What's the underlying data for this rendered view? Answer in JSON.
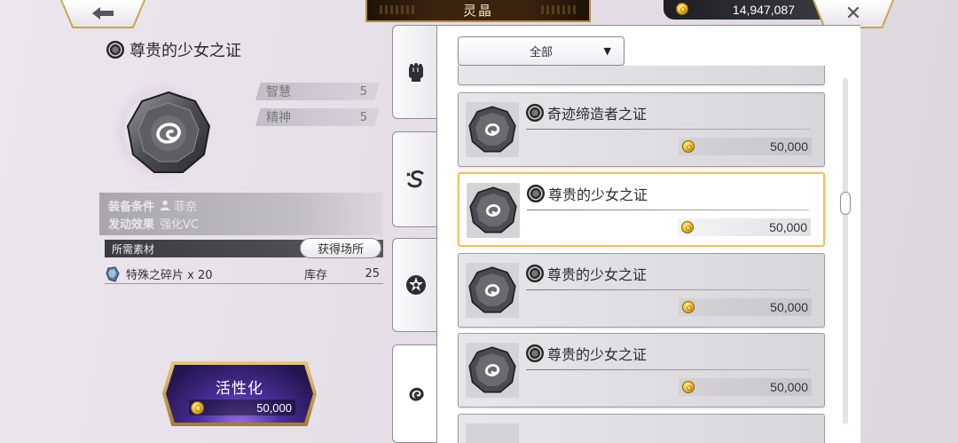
{
  "header": {
    "title": "灵晶",
    "currency_amount": "14,947,087"
  },
  "detail": {
    "name": "尊贵的少女之证",
    "stats": [
      {
        "label": "智慧",
        "value": "5"
      },
      {
        "label": "精神",
        "value": "5"
      }
    ],
    "equip_label": "装备条件",
    "equip_value": "菲奈",
    "effect_label": "发动效果",
    "effect_value": "强化VC",
    "materials_header": "所需素材",
    "obtain_button": "获得场所",
    "material_name": "特殊之碎片 x 20",
    "stock_label": "库存",
    "stock_value": "25",
    "activate_label": "活性化",
    "activate_cost": "50,000"
  },
  "filter": {
    "selected": "全部"
  },
  "list": [
    {
      "name": "奇迹缔造者之证",
      "price": "50,000",
      "selected": false
    },
    {
      "name": "尊贵的少女之证",
      "price": "50,000",
      "selected": true
    },
    {
      "name": "尊贵的少女之证",
      "price": "50,000",
      "selected": false
    },
    {
      "name": "尊贵的少女之证",
      "price": "50,000",
      "selected": false
    }
  ],
  "icons": {
    "back": "back-arrow-icon",
    "close": "close-icon",
    "coin": "gold-coin-icon",
    "tabs": [
      "fist-icon",
      "serpent-icon",
      "star-emblem-icon",
      "swirl-icon"
    ]
  },
  "colors": {
    "selected_border": "#e8c36a",
    "gold_trim": "#c9a64c",
    "activate_purple": "#4a2f9a"
  }
}
